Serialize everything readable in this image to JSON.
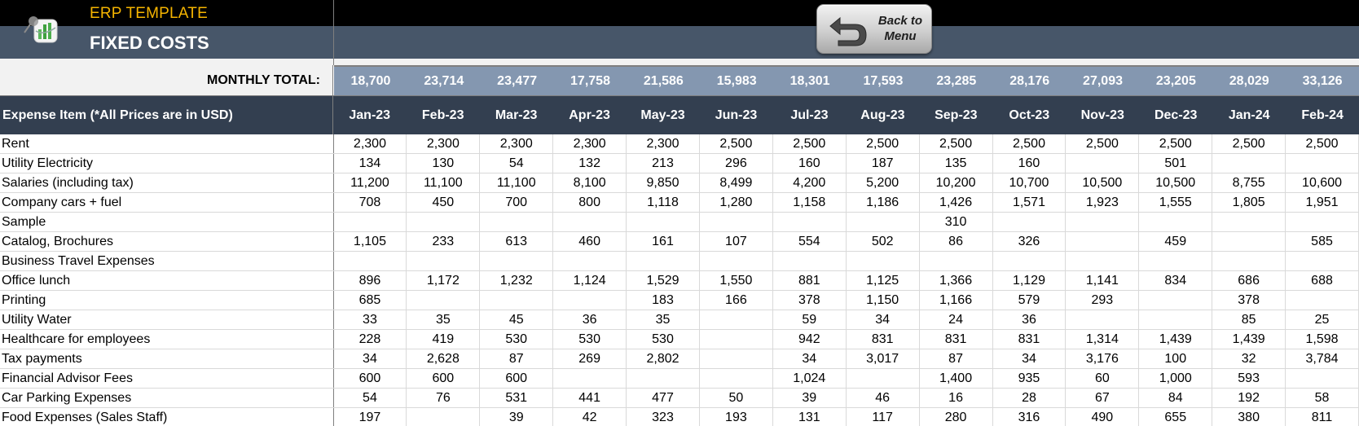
{
  "header": {
    "app_title": "ERP TEMPLATE",
    "page_title": "FIXED COSTS",
    "logo_icon": "chart-magnifier-logo-icon",
    "back_button": {
      "label": "Back to\nMenu",
      "icon": "return-arrow-icon"
    }
  },
  "colors": {
    "title_accent": "#f5b400",
    "header_slate": "#475669",
    "total_bar": "#8497b0",
    "column_header": "#333f50"
  },
  "table": {
    "monthly_total_label": "MONTHLY TOTAL:",
    "first_column_header": "Expense Item (*All Prices are in USD)",
    "months": [
      "Jan-23",
      "Feb-23",
      "Mar-23",
      "Apr-23",
      "May-23",
      "Jun-23",
      "Jul-23",
      "Aug-23",
      "Sep-23",
      "Oct-23",
      "Nov-23",
      "Dec-23",
      "Jan-24",
      "Feb-24"
    ],
    "monthly_totals": [
      "18,700",
      "23,714",
      "23,477",
      "17,758",
      "21,586",
      "15,983",
      "18,301",
      "17,593",
      "23,285",
      "28,176",
      "27,093",
      "23,205",
      "28,029",
      "33,126"
    ],
    "rows": [
      {
        "item": "Rent",
        "values": [
          "2,300",
          "2,300",
          "2,300",
          "2,300",
          "2,300",
          "2,500",
          "2,500",
          "2,500",
          "2,500",
          "2,500",
          "2,500",
          "2,500",
          "2,500",
          "2,500"
        ]
      },
      {
        "item": "Utility Electricity",
        "values": [
          "134",
          "130",
          "54",
          "132",
          "213",
          "296",
          "160",
          "187",
          "135",
          "160",
          "",
          "501",
          "",
          ""
        ]
      },
      {
        "item": "Salaries (including tax)",
        "values": [
          "11,200",
          "11,100",
          "11,100",
          "8,100",
          "9,850",
          "8,499",
          "4,200",
          "5,200",
          "10,200",
          "10,700",
          "10,500",
          "10,500",
          "8,755",
          "10,600"
        ]
      },
      {
        "item": "Company cars + fuel",
        "values": [
          "708",
          "450",
          "700",
          "800",
          "1,118",
          "1,280",
          "1,158",
          "1,186",
          "1,426",
          "1,571",
          "1,923",
          "1,555",
          "1,805",
          "1,951"
        ]
      },
      {
        "item": "Sample",
        "values": [
          "",
          "",
          "",
          "",
          "",
          "",
          "",
          "",
          "310",
          "",
          "",
          "",
          "",
          ""
        ]
      },
      {
        "item": "Catalog, Brochures",
        "values": [
          "1,105",
          "233",
          "613",
          "460",
          "161",
          "107",
          "554",
          "502",
          "86",
          "326",
          "",
          "459",
          "",
          "585"
        ]
      },
      {
        "item": "Business Travel Expenses",
        "values": [
          "",
          "",
          "",
          "",
          "",
          "",
          "",
          "",
          "",
          "",
          "",
          "",
          "",
          ""
        ]
      },
      {
        "item": "Office lunch",
        "values": [
          "896",
          "1,172",
          "1,232",
          "1,124",
          "1,529",
          "1,550",
          "881",
          "1,125",
          "1,366",
          "1,129",
          "1,141",
          "834",
          "686",
          "688"
        ]
      },
      {
        "item": "Printing",
        "values": [
          "685",
          "",
          "",
          "",
          "183",
          "166",
          "378",
          "1,150",
          "1,166",
          "579",
          "293",
          "",
          "378",
          ""
        ]
      },
      {
        "item": "Utility Water",
        "values": [
          "33",
          "35",
          "45",
          "36",
          "35",
          "",
          "59",
          "34",
          "24",
          "36",
          "",
          "",
          "85",
          "25"
        ]
      },
      {
        "item": "Healthcare for employees",
        "values": [
          "228",
          "419",
          "530",
          "530",
          "530",
          "",
          "942",
          "831",
          "831",
          "831",
          "1,314",
          "1,439",
          "1,439",
          "1,598"
        ]
      },
      {
        "item": "Tax payments",
        "values": [
          "34",
          "2,628",
          "87",
          "269",
          "2,802",
          "",
          "34",
          "3,017",
          "87",
          "34",
          "3,176",
          "100",
          "32",
          "3,784"
        ]
      },
      {
        "item": "Financial Advisor Fees",
        "values": [
          "600",
          "600",
          "600",
          "",
          "",
          "",
          "1,024",
          "",
          "1,400",
          "935",
          "60",
          "1,000",
          "593",
          ""
        ]
      },
      {
        "item": "Car Parking Expenses",
        "values": [
          "54",
          "76",
          "531",
          "441",
          "477",
          "50",
          "39",
          "46",
          "16",
          "28",
          "67",
          "84",
          "192",
          "58"
        ]
      },
      {
        "item": "Food Expenses (Sales Staff)",
        "values": [
          "197",
          "",
          "39",
          "42",
          "323",
          "193",
          "131",
          "117",
          "280",
          "316",
          "490",
          "655",
          "380",
          "811"
        ]
      }
    ]
  }
}
